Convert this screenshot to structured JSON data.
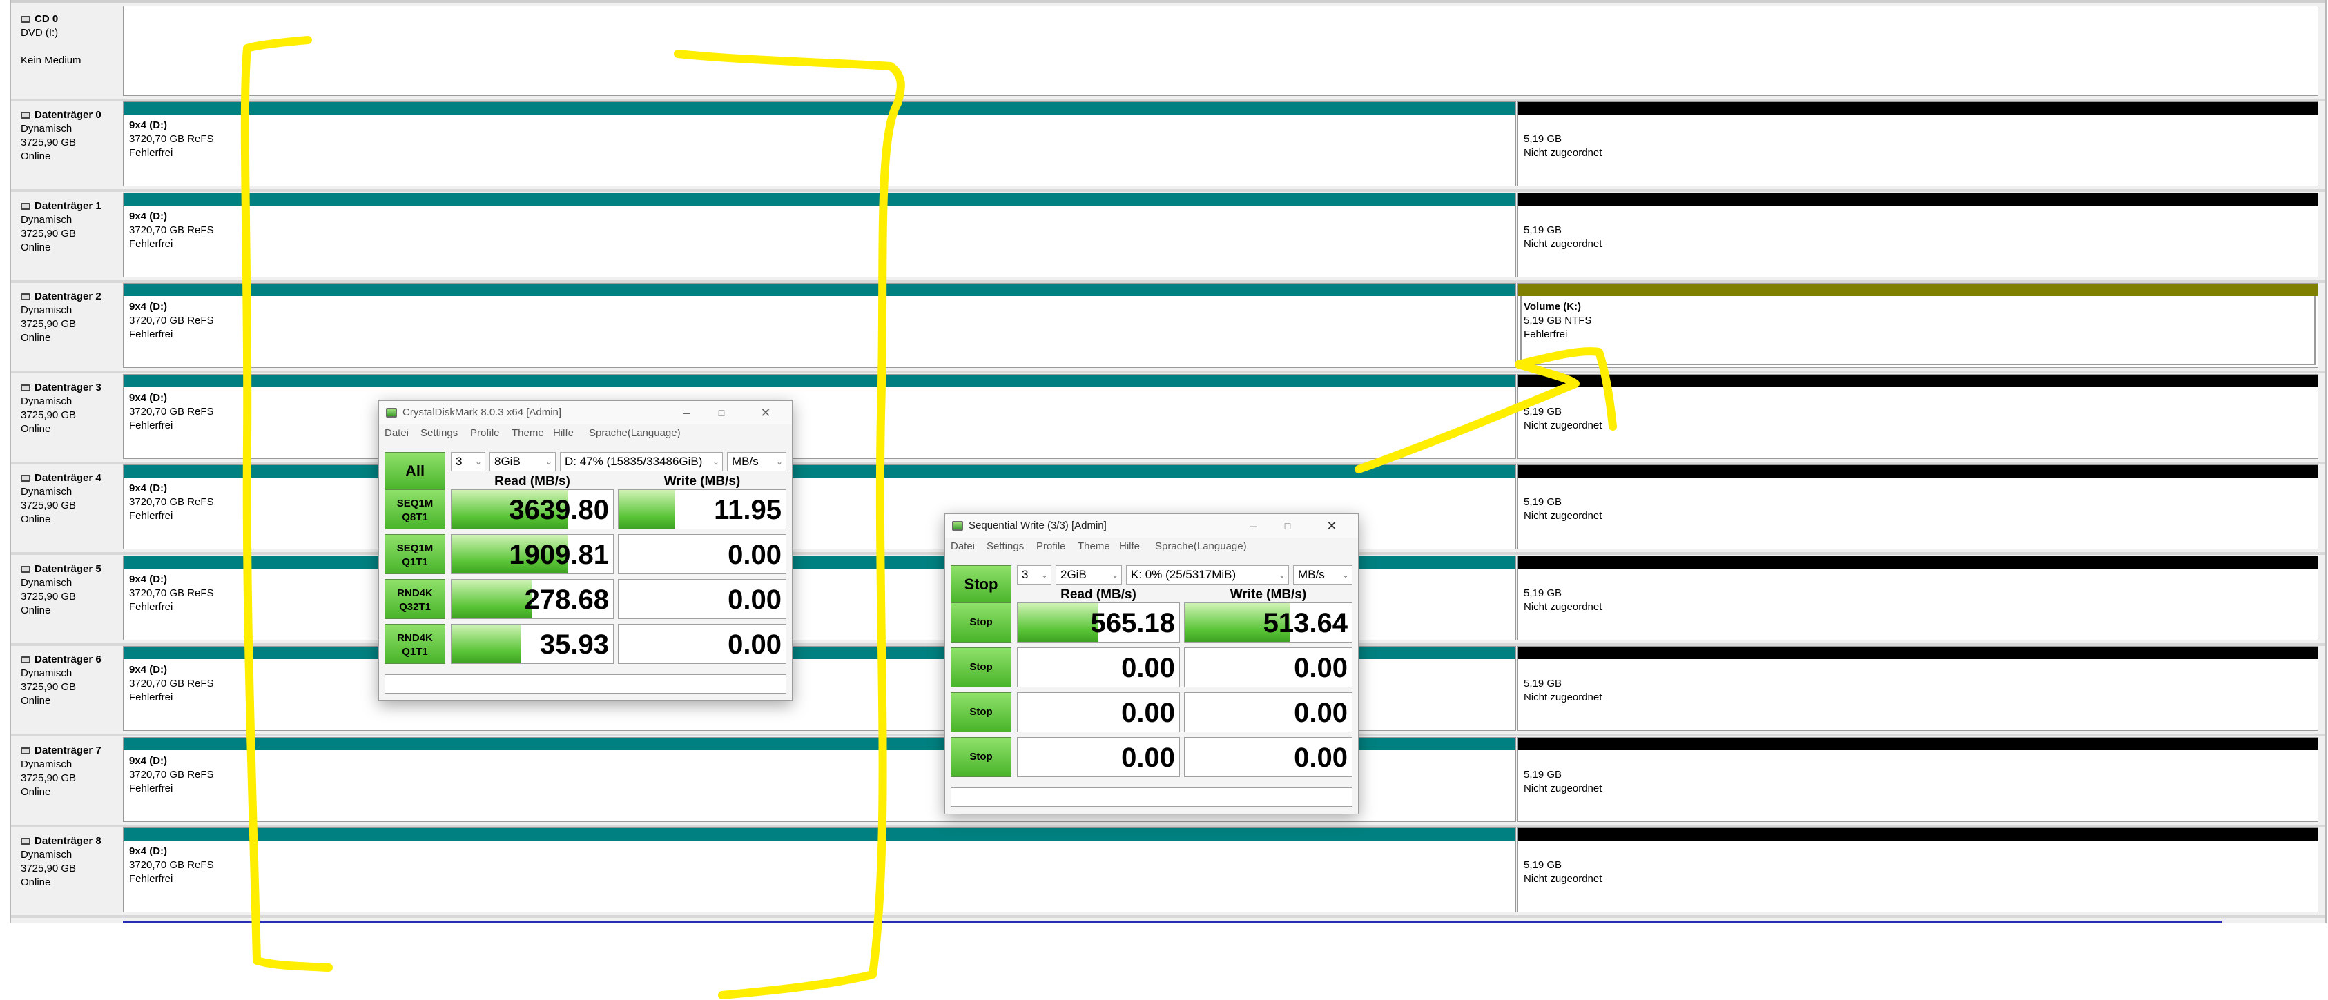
{
  "disk_management": {
    "cd": {
      "name": "CD 0",
      "type": "DVD (I:)",
      "status": "Kein Medium"
    },
    "disks": [
      {
        "name": "Datenträger 0",
        "type": "Dynamisch",
        "size": "3725,90 GB",
        "status": "Online",
        "p1": {
          "name": "9x4  (D:)",
          "size": "3720,70 GB ReFS",
          "status": "Fehlerfrei"
        },
        "p2": {
          "name": "",
          "size": "5,19 GB",
          "status": "Nicht zugeordnet"
        }
      },
      {
        "name": "Datenträger 1",
        "type": "Dynamisch",
        "size": "3725,90 GB",
        "status": "Online",
        "p1": {
          "name": "9x4  (D:)",
          "size": "3720,70 GB ReFS",
          "status": "Fehlerfrei"
        },
        "p2": {
          "name": "",
          "size": "5,19 GB",
          "status": "Nicht zugeordnet"
        }
      },
      {
        "name": "Datenträger 2",
        "type": "Dynamisch",
        "size": "3725,90 GB",
        "status": "Online",
        "p1": {
          "name": "9x4  (D:)",
          "size": "3720,70 GB ReFS",
          "status": "Fehlerfrei"
        },
        "p2": {
          "name": "Volume  (K:)",
          "size": "5,19 GB NTFS",
          "status": "Fehlerfrei"
        }
      },
      {
        "name": "Datenträger 3",
        "type": "Dynamisch",
        "size": "3725,90 GB",
        "status": "Online",
        "p1": {
          "name": "9x4  (D:)",
          "size": "3720,70 GB ReFS",
          "status": "Fehlerfrei"
        },
        "p2": {
          "name": "",
          "size": "5,19 GB",
          "status": "Nicht zugeordnet"
        }
      },
      {
        "name": "Datenträger 4",
        "type": "Dynamisch",
        "size": "3725,90 GB",
        "status": "Online",
        "p1": {
          "name": "9x4  (D:)",
          "size": "3720,70 GB ReFS",
          "status": "Fehlerfrei"
        },
        "p2": {
          "name": "",
          "size": "5,19 GB",
          "status": "Nicht zugeordnet"
        }
      },
      {
        "name": "Datenträger 5",
        "type": "Dynamisch",
        "size": "3725,90 GB",
        "status": "Online",
        "p1": {
          "name": "9x4  (D:)",
          "size": "3720,70 GB ReFS",
          "status": "Fehlerfrei"
        },
        "p2": {
          "name": "",
          "size": "5,19 GB",
          "status": "Nicht zugeordnet"
        }
      },
      {
        "name": "Datenträger 6",
        "type": "Dynamisch",
        "size": "3725,90 GB",
        "status": "Online",
        "p1": {
          "name": "9x4  (D:)",
          "size": "3720,70 GB ReFS",
          "status": "Fehlerfrei"
        },
        "p2": {
          "name": "",
          "size": "5,19 GB",
          "status": "Nicht zugeordnet"
        }
      },
      {
        "name": "Datenträger 7",
        "type": "Dynamisch",
        "size": "3725,90 GB",
        "status": "Online",
        "p1": {
          "name": "9x4  (D:)",
          "size": "3720,70 GB ReFS",
          "status": "Fehlerfrei"
        },
        "p2": {
          "name": "",
          "size": "5,19 GB",
          "status": "Nicht zugeordnet"
        }
      },
      {
        "name": "Datenträger 8",
        "type": "Dynamisch",
        "size": "3725,90 GB",
        "status": "Online",
        "p1": {
          "name": "9x4  (D:)",
          "size": "3720,70 GB ReFS",
          "status": "Fehlerfrei"
        },
        "p2": {
          "name": "",
          "size": "5,19 GB",
          "status": "Nicht zugeordnet"
        }
      }
    ],
    "colors": {
      "dynamic_volume": "#008080",
      "unallocated": "#000000",
      "ntfs_volume": "#808000",
      "strip": "#2a2ab5"
    }
  },
  "cdm1": {
    "title": "CrystalDiskMark 8.0.3 x64 [Admin]",
    "menu": [
      "Datei",
      "Settings",
      "Profile",
      "Theme",
      "Hilfe",
      "Sprache(Language)"
    ],
    "count": "3",
    "size": "8GiB",
    "drive": "D: 47% (15835/33486GiB)",
    "unit": "MB/s",
    "all_label": "All",
    "read_header": "Read (MB/s)",
    "write_header": "Write (MB/s)",
    "rows": [
      {
        "l1": "SEQ1M",
        "l2": "Q8T1",
        "read": "3639.80",
        "write": "11.95",
        "read_level": 0.72,
        "write_level": 0.34
      },
      {
        "l1": "SEQ1M",
        "l2": "Q1T1",
        "read": "1909.81",
        "write": "0.00",
        "read_level": 0.72,
        "write_level": 0
      },
      {
        "l1": "RND4K",
        "l2": "Q32T1",
        "read": "278.68",
        "write": "0.00",
        "read_level": 0.5,
        "write_level": 0
      },
      {
        "l1": "RND4K",
        "l2": "Q1T1",
        "read": "35.93",
        "write": "0.00",
        "read_level": 0.43,
        "write_level": 0
      }
    ]
  },
  "cdm2": {
    "title": "Sequential Write (3/3) [Admin]",
    "menu": [
      "Datei",
      "Settings",
      "Profile",
      "Theme",
      "Hilfe",
      "Sprache(Language)"
    ],
    "count": "3",
    "size": "2GiB",
    "drive": "K: 0% (25/5317MiB)",
    "unit": "MB/s",
    "all_label": "Stop",
    "read_header": "Read (MB/s)",
    "write_header": "Write (MB/s)",
    "rows": [
      {
        "label": "Stop",
        "read": "565.18",
        "write": "513.64",
        "read_level": 0.5,
        "write_level": 0.63
      },
      {
        "label": "Stop",
        "read": "0.00",
        "write": "0.00",
        "read_level": 0,
        "write_level": 0
      },
      {
        "label": "Stop",
        "read": "0.00",
        "write": "0.00",
        "read_level": 0,
        "write_level": 0
      },
      {
        "label": "Stop",
        "read": "0.00",
        "write": "0.00",
        "read_level": 0,
        "write_level": 0
      }
    ]
  },
  "annotation": {
    "color": "#ffee00"
  }
}
